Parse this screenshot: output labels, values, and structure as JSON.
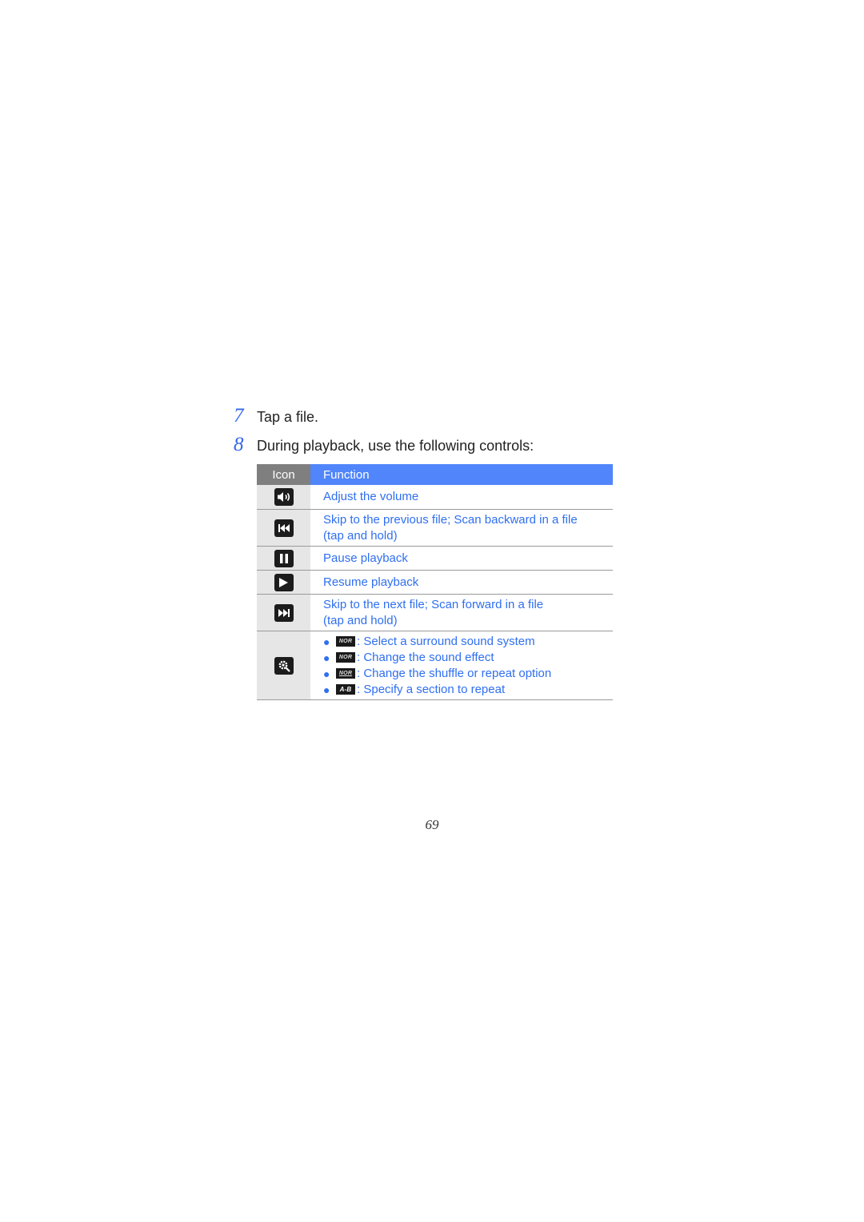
{
  "steps": [
    {
      "number": "7",
      "text": "Tap a file."
    },
    {
      "number": "8",
      "text": "During playback, use the following controls:"
    }
  ],
  "table": {
    "headers": {
      "icon": "Icon",
      "function": "Function"
    },
    "rows": [
      {
        "icon": "volume-icon",
        "function_lines": [
          "Adjust the volume"
        ]
      },
      {
        "icon": "skip-previous-icon",
        "function_lines": [
          "Skip to the previous file; Scan backward in a file",
          "(tap and hold)"
        ]
      },
      {
        "icon": "pause-icon",
        "function_lines": [
          "Pause playback"
        ]
      },
      {
        "icon": "play-icon",
        "function_lines": [
          "Resume playback"
        ]
      },
      {
        "icon": "skip-next-icon",
        "function_lines": [
          "Skip to the next file; Scan forward in a file",
          "(tap and hold)"
        ]
      },
      {
        "icon": "settings-icon",
        "options": [
          {
            "badge": "NOR",
            "badge_icon": "surround-sound-badge-icon",
            "separator": ":",
            "text": "Select a surround sound system"
          },
          {
            "badge": "NOR",
            "badge_icon": "sound-effect-badge-icon",
            "separator": ":",
            "text": "Change the sound effect"
          },
          {
            "badge": "NOR",
            "badge_icon": "shuffle-repeat-badge-icon",
            "separator": ":",
            "text": "Change the shuffle or repeat option"
          },
          {
            "badge": "A-B",
            "badge_icon": "ab-repeat-badge-icon",
            "separator": ":",
            "text": "Specify a section to repeat"
          }
        ]
      }
    ]
  },
  "page_number": "69",
  "colors": {
    "accent_blue": "#5085fb",
    "link_text": "#2f6ff0",
    "header_gray": "#7f7f7f",
    "icon_column_bg": "#e6e6e6"
  }
}
